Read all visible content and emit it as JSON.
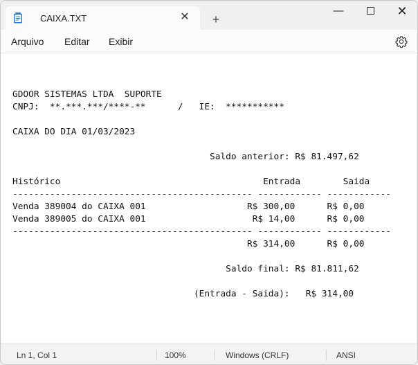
{
  "tab": {
    "title": "CAIXA.TXT",
    "close_glyph": "✕",
    "new_tab_glyph": "+"
  },
  "window_controls": {
    "minimize": "—",
    "close": "✕"
  },
  "menu": {
    "items": [
      "Arquivo",
      "Editar",
      "Exibir"
    ]
  },
  "document": {
    "lines": [
      "GDOOR SISTEMAS LTDA  SUPORTE",
      "CNPJ:  **.***.***/****-**      /   IE:  ***********",
      "",
      "CAIXA DO DIA 01/03/2023",
      "",
      "                                     Saldo anterior: R$ 81.497,62",
      "",
      "Histórico                                      Entrada        Saida",
      "--------------------------------------------- ------------ ------------",
      "Venda 389004 do CAIXA 001                   R$ 300,00      R$ 0,00",
      "Venda 389005 do CAIXA 001                    R$ 14,00      R$ 0,00",
      "--------------------------------------------- ------------ ------------",
      "                                            R$ 314,00      R$ 0,00",
      "",
      "                                        Saldo final: R$ 81.811,62",
      "",
      "                                  (Entrada - Saida):   R$ 314,00"
    ]
  },
  "status": {
    "position": "Ln 1, Col 1",
    "zoom": "100%",
    "line_ending": "Windows (CRLF)",
    "encoding": "ANSI"
  },
  "colors": {
    "accent": "#0067c0",
    "text": "#111111"
  }
}
